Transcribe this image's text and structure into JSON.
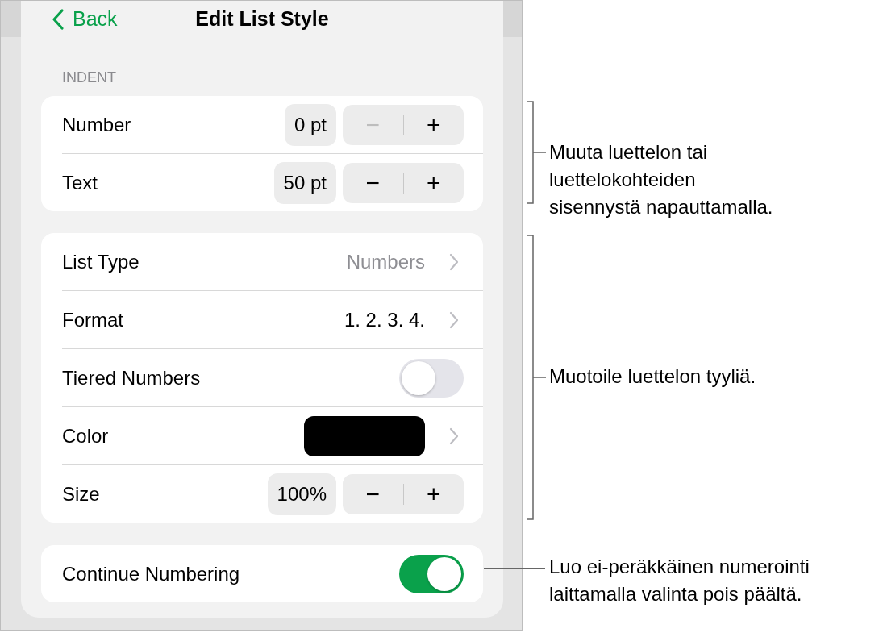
{
  "header": {
    "back": "Back",
    "title": "Edit List Style"
  },
  "indent": {
    "heading": "INDENT",
    "rows": [
      {
        "label": "Number",
        "value": "0 pt",
        "minus": "−",
        "plus": "+",
        "minus_disabled": true
      },
      {
        "label": "Text",
        "value": "50 pt",
        "minus": "−",
        "plus": "+",
        "minus_disabled": false
      }
    ]
  },
  "style_rows": [
    {
      "kind": "picker",
      "label": "List Type",
      "value": "Numbers",
      "value_muted": true
    },
    {
      "kind": "picker",
      "label": "Format",
      "value": "1. 2. 3. 4.",
      "value_muted": false
    },
    {
      "kind": "toggle",
      "label": "Tiered Numbers",
      "on": false
    },
    {
      "kind": "color",
      "label": "Color",
      "color": "#000000"
    },
    {
      "kind": "stepper",
      "label": "Size",
      "value": "100%",
      "minus": "−",
      "plus": "+",
      "minus_disabled": false
    }
  ],
  "continue": {
    "label": "Continue Numbering",
    "on": true
  },
  "callouts": [
    {
      "kind": "bracket",
      "text": "Muuta luettelon tai\nluettelokohteiden\nsisennystä napauttamalla."
    },
    {
      "kind": "bracket",
      "text": "Muotoile luettelon tyyliä."
    },
    {
      "kind": "line",
      "text": "Luo ei-peräkkäinen numerointi\nlaittamalla valinta pois päältä."
    }
  ]
}
